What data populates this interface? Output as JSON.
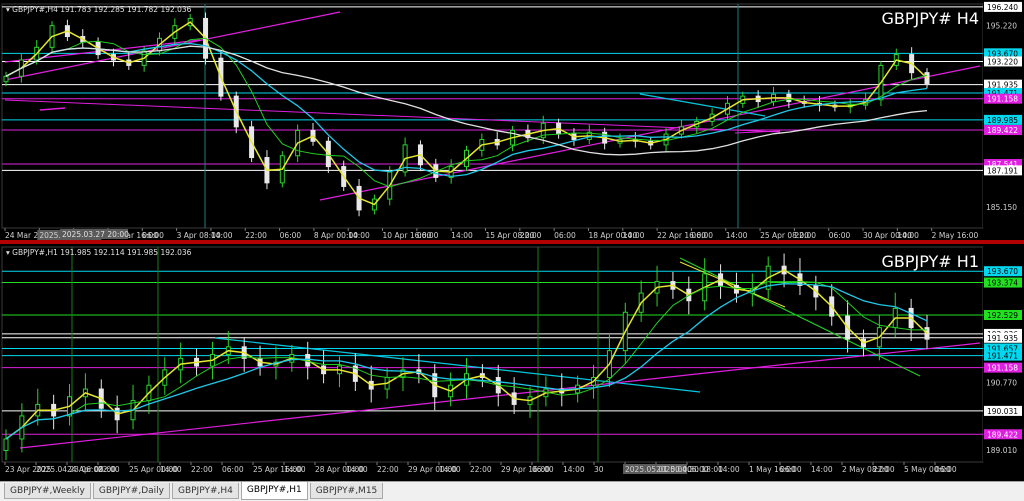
{
  "colors": {
    "background": "#000000",
    "grid": "#1a1a1a",
    "candle_up": "#2bd42b",
    "candle_down": "#e8e8e8",
    "ma_fast": "#e6e62e",
    "ma_mid": "#21cc21",
    "ma_slow": "#1ec8e8",
    "ma_long": "#e0e0e0",
    "trendline": "#e01ee0",
    "channel": "#00c8e0",
    "level_white": "#ffffff",
    "level_cyan": "#00d8f0",
    "level_green": "#20e020",
    "level_magenta": "#e020e0",
    "separator": "#c00000"
  },
  "chart_data": [
    {
      "type": "line",
      "title": "GBPJPY# H4",
      "header": "GBPJPY#,H4  191.783 192.285 191.782 192.036",
      "time_range": "2025-03-24 to 2025-05-02",
      "x_ticks": [
        "24 Mar 2025",
        "2025.03.28 03:00",
        "22:00",
        "31 Mar 16:00",
        "06:00",
        "3 Apr 08:00",
        "14:00",
        "22:00",
        "06:00",
        "8 Apr 00:00",
        "14:00",
        "10 Apr 16:00",
        "06:00",
        "14:00",
        "15 Apr 08:00",
        "22:00",
        "06:00",
        "18 Apr 00:00",
        "14:00",
        "22 Apr 16:00",
        "06:00",
        "14:00",
        "25 Apr 08:00",
        "22:00",
        "06:00",
        "30 Apr 00:00",
        "14:00",
        "2 May 16:00"
      ],
      "crosshair_time": "2025.03.27 20:00",
      "y_ticks": [
        "196.240",
        "195.220",
        "193.670",
        "193.220",
        "191.935",
        "191.471",
        "191.158",
        "189.985",
        "189.422",
        "187.541",
        "187.191",
        "185.150"
      ],
      "ylim": [
        184.0,
        196.4
      ],
      "close_series": [
        192.4,
        193.3,
        194.0,
        195.2,
        194.6,
        194.3,
        193.6,
        193.3,
        193.0,
        193.8,
        194.5,
        195.2,
        195.6,
        193.4,
        191.3,
        189.6,
        187.9,
        186.5,
        188.0,
        189.4,
        188.8,
        187.4,
        186.3,
        185.0,
        185.6,
        187.1,
        188.6,
        187.5,
        186.8,
        187.4,
        188.3,
        188.9,
        188.6,
        189.4,
        189.0,
        189.8,
        189.2,
        188.9,
        189.3,
        188.7,
        188.9,
        188.8,
        188.6,
        189.2,
        189.6,
        189.9,
        190.3,
        190.9,
        191.3,
        191.0,
        191.4,
        191.0,
        190.9,
        190.8,
        190.7,
        190.8,
        191.1,
        193.0,
        193.6,
        192.6,
        192.0
      ],
      "levels": [
        {
          "value": 196.24,
          "label": "196.240",
          "kind": "white"
        },
        {
          "value": 193.67,
          "label": "193.670",
          "kind": "cyan"
        },
        {
          "value": 193.22,
          "label": "193.220",
          "kind": "white"
        },
        {
          "value": 191.935,
          "label": "191.935",
          "kind": "white"
        },
        {
          "value": 191.471,
          "label": "191.471",
          "kind": "cyan"
        },
        {
          "value": 191.158,
          "label": "191.158",
          "kind": "magenta"
        },
        {
          "value": 189.985,
          "label": "189.985",
          "kind": "cyan"
        },
        {
          "value": 189.422,
          "label": "189.422",
          "kind": "magenta"
        },
        {
          "value": 187.541,
          "label": "187.541",
          "kind": "magenta"
        },
        {
          "value": 187.191,
          "label": "187.191",
          "kind": "white"
        }
      ]
    },
    {
      "type": "line",
      "title": "GBPJPY# H1",
      "header": "GBPJPY#,H1  191.985 192.114 191.985 192.036",
      "time_range": "2025-04-23 to 2025-05-05",
      "x_ticks": [
        "23 Apr 2025",
        "2025.04.23 06:00",
        "24 Apr 08:00",
        "22:00",
        "25 Apr 00:00",
        "14:00",
        "22:00",
        "06:00",
        "25 Apr 16:00",
        "14:00",
        "28 Apr 00:00",
        "14:00",
        "22:00",
        "29 Apr 00:00",
        "14:00",
        "22:00",
        "29 Apr 16:00",
        "06:00",
        "14:00",
        "30",
        "2025.05.01 00:00",
        "2025.04.30 18:00",
        "06:00",
        "14:00",
        "1 May 16:00",
        "06:00",
        "14:00",
        "2 May 08:00",
        "22:00",
        "5 May 00:00",
        "06:00"
      ],
      "y_ticks": [
        "193.670",
        "193.374",
        "192.529",
        "191.935",
        "191.657",
        "191.471",
        "191.158",
        "190.770",
        "190.031",
        "189.422",
        "189.010"
      ],
      "ylim": [
        188.7,
        194.3
      ],
      "close_series": [
        189.3,
        189.9,
        190.2,
        189.9,
        190.4,
        190.6,
        190.1,
        189.8,
        190.3,
        190.7,
        191.1,
        191.4,
        191.2,
        191.5,
        191.7,
        191.4,
        191.2,
        191.3,
        191.5,
        191.2,
        191.0,
        191.2,
        190.8,
        190.6,
        190.9,
        191.1,
        191.0,
        190.4,
        190.7,
        191.0,
        190.9,
        190.5,
        190.2,
        190.4,
        190.6,
        190.5,
        190.7,
        190.9,
        191.6,
        192.6,
        193.1,
        193.4,
        193.2,
        192.9,
        193.6,
        193.3,
        193.1,
        193.2,
        193.8,
        193.6,
        193.3,
        193.0,
        192.5,
        191.9,
        191.7,
        192.2,
        192.7,
        192.2,
        191.9
      ],
      "levels": [
        {
          "value": 193.67,
          "label": "193.670",
          "kind": "cyan"
        },
        {
          "value": 193.374,
          "label": "193.374",
          "kind": "green"
        },
        {
          "value": 192.529,
          "label": "192.529",
          "kind": "green"
        },
        {
          "value": 192.036,
          "label": "192.036",
          "kind": "white"
        },
        {
          "value": 191.935,
          "label": "191.935",
          "kind": "white"
        },
        {
          "value": 191.657,
          "label": "191.657",
          "kind": "cyan"
        },
        {
          "value": 191.471,
          "label": "191.471",
          "kind": "cyan"
        },
        {
          "value": 191.158,
          "label": "191.158",
          "kind": "magenta"
        },
        {
          "value": 190.031,
          "label": "190.031",
          "kind": "white"
        },
        {
          "value": 189.422,
          "label": "189.422",
          "kind": "magenta"
        }
      ]
    }
  ],
  "tabs": [
    "GBPJPY#,Weekly",
    "GBPJPY#,Daily",
    "GBPJPY#,H4",
    "GBPJPY#,H1",
    "GBPJPY#,M15"
  ],
  "active_tab": 3
}
